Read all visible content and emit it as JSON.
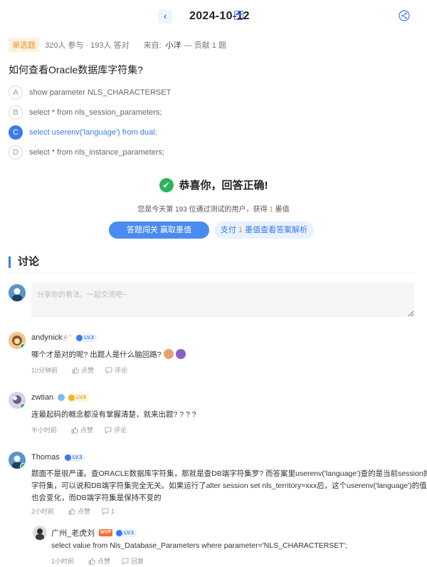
{
  "header": {
    "back_icon": "chevron-left-icon",
    "date": "2024-10-12",
    "calendar_icon": "calendar-icon",
    "share_icon": "share-icon"
  },
  "meta": {
    "type": "单选题",
    "stats": "320人 参与 · 193人 答对",
    "from_label": "来自:",
    "author": "小洋",
    "contribution": "— 贡献 1 题"
  },
  "question": "如何查看Oracle数据库字符集?",
  "options": [
    {
      "letter": "A",
      "text": "show parameter NLS_CHARACTERSET"
    },
    {
      "letter": "B",
      "text": "select * from nls_session_parameters;"
    },
    {
      "letter": "C",
      "text": "select userenv('language') from dual;",
      "selected": true
    },
    {
      "letter": "D",
      "text": "select * from nls_instance_parameters;"
    }
  ],
  "result": {
    "title": "恭喜你，回答正确!",
    "sub_prefix": "您是今天第 193 位通过测试的用户，获得 ",
    "sub_amount": "1",
    "sub_suffix": " 墨值",
    "btn_primary": "答题闯关 赢取墨值",
    "btn_secondary_prefix": "支付 ",
    "btn_secondary_amount": "1",
    "btn_secondary_suffix": " 墨值查看答案解析"
  },
  "discussion": {
    "title": "讨论",
    "placeholder": "分享你的看法，一起交流吧~",
    "comments": [
      {
        "name": "andynick",
        "suffix": "ⓔ ˇ",
        "level": "LV.3",
        "text": "哪个才是对的呢? 出题人是什么脑回路?",
        "time": "10分钟前",
        "like": "点赞",
        "reply": "评论"
      },
      {
        "name": "zwtian",
        "level": "LV.5",
        "text": "连最起码的概念都没有掌握清楚，就来出题? ? ? ?",
        "time": "半小时前",
        "like": "点赞",
        "reply": "评论"
      },
      {
        "name": "Thomas",
        "level": "LV.3",
        "text_lines": [
          "题面不是很严谨。查ORACLE数据库字符集，那就是查DB端字符集罗? 而答案里userenv('language')查的是当前session的",
          "字符集，可以说和DB端字符集完全无关。如果运行了alter session set nls_territory=xxx后，这个userenv('language')的值",
          "也会变化，而DB端字符集是保持不变的"
        ],
        "time": "2小时前",
        "like": "点赞",
        "reply": "1"
      },
      {
        "name": "广州_老虎刘",
        "mvp": "MVP",
        "level": "LV.3",
        "text": "select value from Nls_Database_Parameters where parameter='NLS_CHARACTERSET';",
        "time": "1小时前",
        "like": "点赞",
        "reply": "回复"
      }
    ]
  }
}
